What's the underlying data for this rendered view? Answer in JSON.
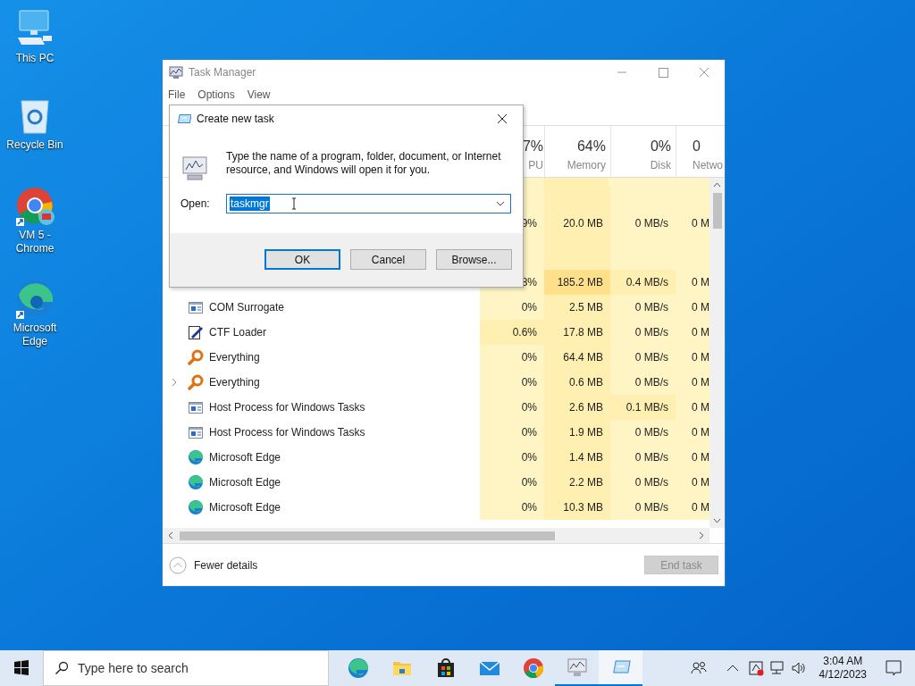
{
  "desktop_icons": [
    {
      "kind": "pc",
      "label": "This PC"
    },
    {
      "kind": "bin",
      "label": "Recycle Bin"
    },
    {
      "kind": "chrome",
      "label": "VM 5 - Chrome"
    },
    {
      "kind": "edge",
      "label": "Microsoft Edge"
    }
  ],
  "task_manager": {
    "title": "Task Manager",
    "menu": [
      "File",
      "Options",
      "View"
    ],
    "columns": [
      {
        "percent": "7%",
        "label": "PU"
      },
      {
        "percent": "64%",
        "label": "Memory"
      },
      {
        "percent": "0%",
        "label": "Disk"
      },
      {
        "percent": "0",
        "label": "Netwo"
      }
    ],
    "rows": [
      {
        "kind": "blank"
      },
      {
        "kind": "hidden",
        "cpu": "9%",
        "memory": "20.0 MB",
        "disk": "0 MB/s",
        "network": "0 M"
      },
      {
        "kind": "group"
      },
      {
        "kind": "hidden",
        "cpu": "8%",
        "memory": "185.2 MB",
        "disk": "0.4 MB/s",
        "network": "0 M"
      },
      {
        "kind": "window",
        "name": "COM Surrogate",
        "expandable": false,
        "cpu": "0%",
        "memory": "2.5 MB",
        "disk": "0 MB/s",
        "network": "0 M"
      },
      {
        "kind": "pen",
        "name": "CTF Loader",
        "expandable": false,
        "cpu": "0.6%",
        "memory": "17.8 MB",
        "disk": "0 MB/s",
        "network": "0 M"
      },
      {
        "kind": "magnifier",
        "name": "Everything",
        "expandable": false,
        "cpu": "0%",
        "memory": "64.4 MB",
        "disk": "0 MB/s",
        "network": "0 M"
      },
      {
        "kind": "magnifier",
        "name": "Everything",
        "expandable": true,
        "cpu": "0%",
        "memory": "0.6 MB",
        "disk": "0 MB/s",
        "network": "0 M"
      },
      {
        "kind": "window",
        "name": "Host Process for Windows Tasks",
        "expandable": false,
        "cpu": "0%",
        "memory": "2.6 MB",
        "disk": "0.1 MB/s",
        "network": "0 M"
      },
      {
        "kind": "window",
        "name": "Host Process for Windows Tasks",
        "expandable": false,
        "cpu": "0%",
        "memory": "1.9 MB",
        "disk": "0 MB/s",
        "network": "0 M"
      },
      {
        "kind": "edge",
        "name": "Microsoft Edge",
        "expandable": false,
        "cpu": "0%",
        "memory": "1.4 MB",
        "disk": "0 MB/s",
        "network": "0 M"
      },
      {
        "kind": "edge",
        "name": "Microsoft Edge",
        "expandable": false,
        "cpu": "0%",
        "memory": "2.2 MB",
        "disk": "0 MB/s",
        "network": "0 M"
      },
      {
        "kind": "edge",
        "name": "Microsoft Edge",
        "expandable": false,
        "cpu": "0%",
        "memory": "10.3 MB",
        "disk": "0 MB/s",
        "network": "0 M"
      }
    ],
    "fewer_details": "Fewer details",
    "end_task": {
      "label": "End task",
      "disabled": true
    }
  },
  "dialog": {
    "title": "Create new task",
    "message": "Type the name of a program, folder, document, or Internet resource, and Windows will open it for you.",
    "open_label": "Open:",
    "value": "taskmgr",
    "value_selected": true,
    "buttons": [
      {
        "label": "OK",
        "default": true
      },
      {
        "label": "Cancel",
        "default": false
      },
      {
        "label": "Browse...",
        "default": false
      }
    ]
  },
  "taskbar": {
    "search_placeholder": "Type here to search",
    "apps": [
      {
        "kind": "edge",
        "running": false,
        "selected": false
      },
      {
        "kind": "folder",
        "running": false,
        "selected": false
      },
      {
        "kind": "store",
        "running": false,
        "selected": false
      },
      {
        "kind": "mail",
        "running": false,
        "selected": false
      },
      {
        "kind": "chrome",
        "running": false,
        "selected": false
      },
      {
        "kind": "taskmgr",
        "running": true,
        "selected": false
      },
      {
        "kind": "run",
        "running": true,
        "selected": true
      }
    ],
    "time": "3:04 AM",
    "date": "4/12/2023"
  }
}
